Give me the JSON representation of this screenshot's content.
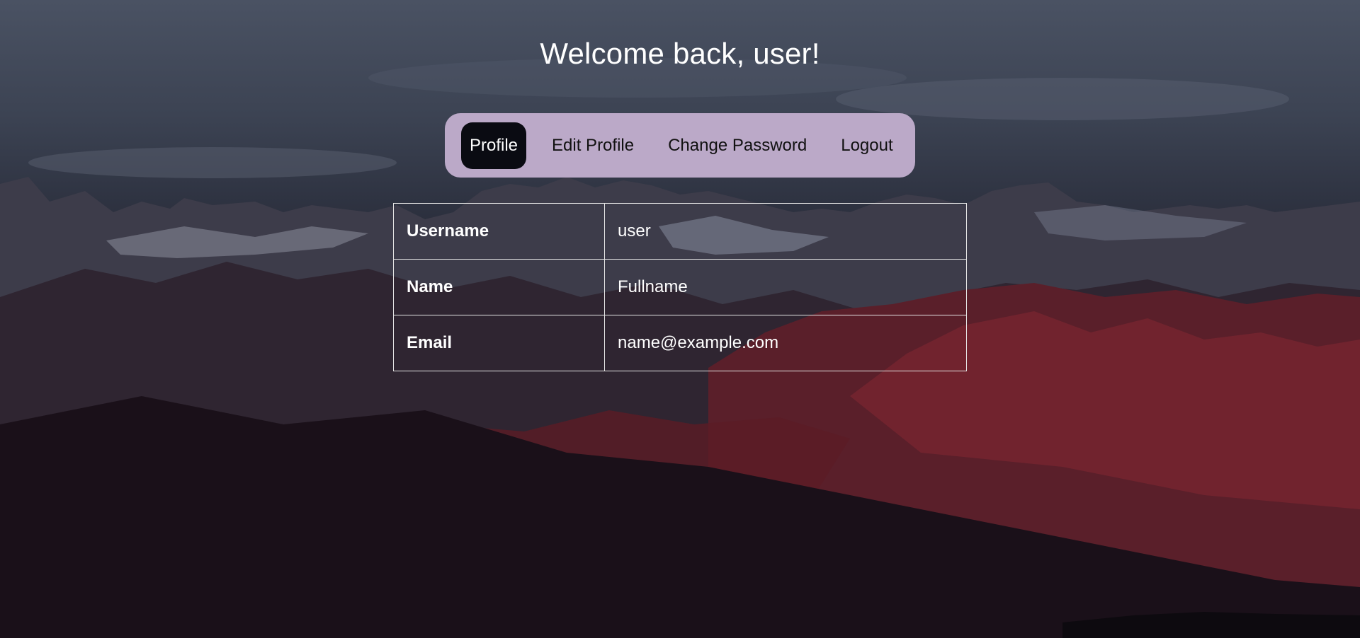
{
  "page": {
    "welcome": "Welcome back, user!"
  },
  "nav": {
    "items": [
      {
        "label": "Profile",
        "active": true
      },
      {
        "label": "Edit Profile",
        "active": false
      },
      {
        "label": "Change Password",
        "active": false
      },
      {
        "label": "Logout",
        "active": false
      }
    ]
  },
  "profile": {
    "rows": [
      {
        "label": "Username",
        "value": "user"
      },
      {
        "label": "Name",
        "value": "Fullname"
      },
      {
        "label": "Email",
        "value": "name@example.com"
      }
    ]
  },
  "colors": {
    "nav_background": "#bba9c8",
    "nav_active": "#0a0b12",
    "text": "#ffffff"
  }
}
